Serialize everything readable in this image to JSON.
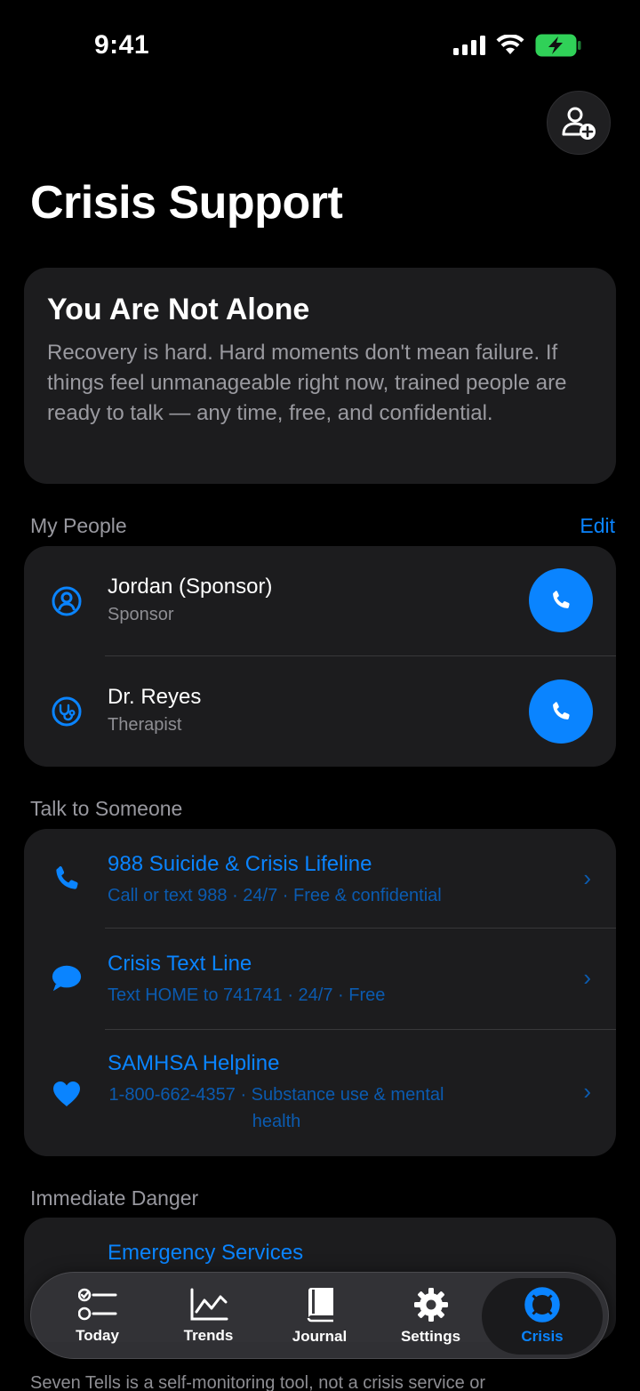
{
  "status": {
    "time": "9:41"
  },
  "header": {
    "title": "Crisis Support",
    "add_contact_icon": "person-add-icon"
  },
  "hero": {
    "title": "You Are Not Alone",
    "body": "Recovery is hard. Hard moments don't mean failure. If things feel unmanageable right now, trained people are ready to talk — any time, free, and confidential."
  },
  "my_people": {
    "label": "My People",
    "action": "Edit",
    "items": [
      {
        "name": "Jordan (Sponsor)",
        "role": "Sponsor",
        "icon": "person-circle-icon"
      },
      {
        "name": "Dr. Reyes",
        "role": "Therapist",
        "icon": "stethoscope-icon"
      }
    ]
  },
  "talk": {
    "label": "Talk to Someone",
    "items": [
      {
        "title": "988 Suicide & Crisis Lifeline",
        "sub": "Call or text 988 · 24/7 · Free & confidential",
        "icon": "phone-icon"
      },
      {
        "title": "Crisis Text Line",
        "sub": "Text HOME to 741741 · 24/7 · Free",
        "icon": "message-bubble-icon"
      },
      {
        "title": "SAMHSA Helpline",
        "sub": "1-800-662-4357 · Substance use & mental health",
        "icon": "heart-icon"
      }
    ]
  },
  "danger": {
    "label": "Immediate Danger",
    "items": [
      {
        "title": "Emergency Services"
      }
    ]
  },
  "tabs": [
    {
      "label": "Today",
      "icon": "checklist-icon"
    },
    {
      "label": "Trends",
      "icon": "chart-line-icon"
    },
    {
      "label": "Journal",
      "icon": "book-icon"
    },
    {
      "label": "Settings",
      "icon": "gear-icon"
    },
    {
      "label": "Crisis",
      "icon": "lifebuoy-icon",
      "active": true
    }
  ],
  "footer": {
    "disclaimer": "Seven Tells is a self-monitoring tool, not a crisis service or"
  },
  "colors": {
    "accent": "#0a84ff",
    "card": "#1c1c1e",
    "battery": "#30d158"
  }
}
